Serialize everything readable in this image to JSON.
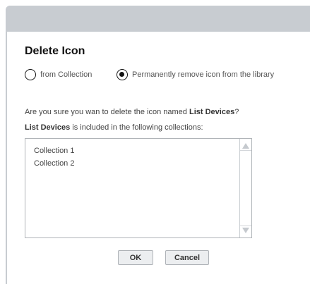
{
  "dialog": {
    "title": "Delete Icon",
    "options": [
      {
        "label": "from Collection",
        "selected": false
      },
      {
        "label": "Permanently remove icon from the library",
        "selected": true
      }
    ],
    "confirm_prefix": "Are you sure you wan to delete the icon named ",
    "icon_name": "List Devices",
    "confirm_suffix": "?",
    "collections_suffix": " is included in the following collections:",
    "collections": [
      "Collection 1",
      "Collection 2"
    ],
    "ok_label": "OK",
    "cancel_label": "Cancel"
  },
  "colors": {
    "frame": "#c8ccd1",
    "text": "#444444"
  }
}
